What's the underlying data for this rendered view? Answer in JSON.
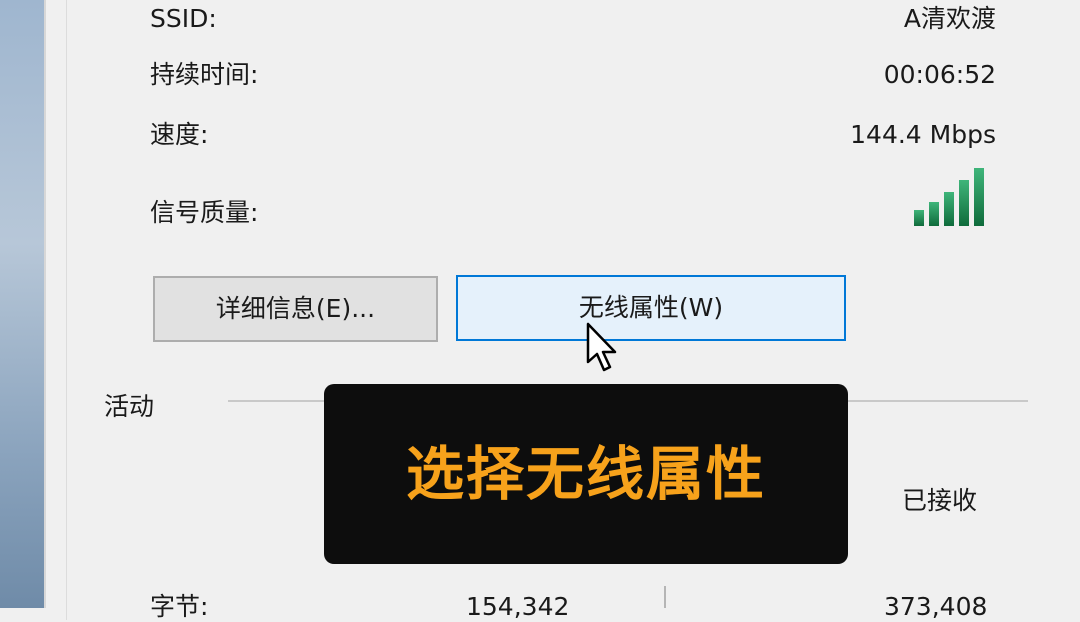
{
  "details": {
    "ssid": {
      "label": "SSID:",
      "value": "A清欢渡"
    },
    "duration": {
      "label": "持续时间:",
      "value": "00:06:52"
    },
    "speed": {
      "label": "速度:",
      "value": "144.4 Mbps"
    },
    "signal": {
      "label": "信号质量:",
      "icon": "wifi-signal-bars-icon",
      "bars_filled": 5,
      "bars_total": 5
    }
  },
  "buttons": {
    "details_label": "详细信息(E)...",
    "wireless_label": "无线属性(W)"
  },
  "activity": {
    "section_label": "活动",
    "received_label": "已接收",
    "bytes_label_partial": "字节:",
    "sent_value_partial": "154,342",
    "received_value_partial": "373,408"
  },
  "caption": {
    "text": "选择无线属性"
  },
  "colors": {
    "accent": "#0078d7",
    "button_hover_bg": "#e5f1fb",
    "signal_green": "#1f8a52",
    "caption_text": "#f7a21b",
    "caption_bg": "#0d0d0d"
  }
}
